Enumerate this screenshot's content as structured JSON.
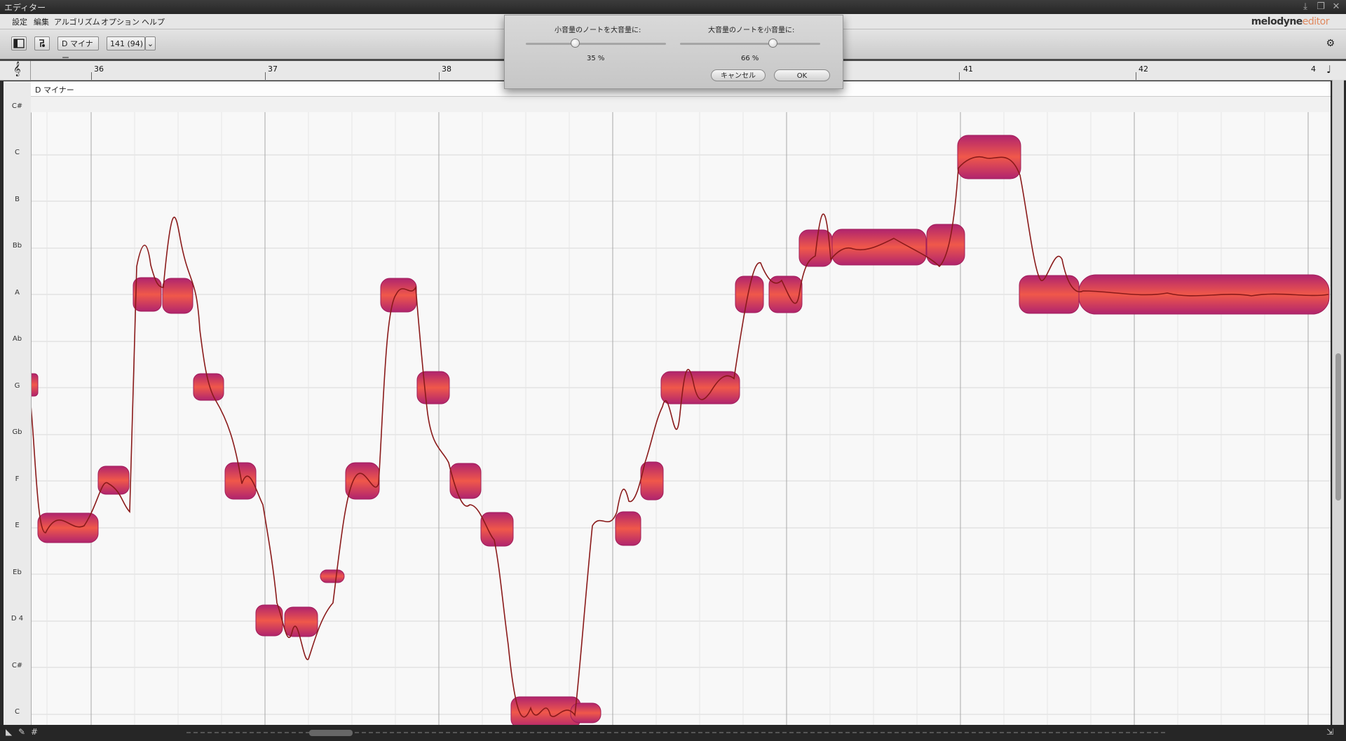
{
  "window": {
    "title": "エディター"
  },
  "menu": [
    "設定",
    "編集",
    "アルゴリズム",
    "オプション",
    "ヘルプ"
  ],
  "brand": {
    "name": "melodyne",
    "suffix": "editor"
  },
  "toolbar": {
    "scale": "D マイナー",
    "tempo": "141 (94)",
    "icons": [
      "sidebar-toggle-icon",
      "pitch-tool-icon",
      "gear-icon"
    ]
  },
  "ruler": {
    "bars": [
      "36",
      "37",
      "38",
      "41",
      "42",
      "4"
    ]
  },
  "scale_band": {
    "label": "D マイナー"
  },
  "pitch_labels": [
    "C#",
    "C",
    "B",
    "Bb",
    "A",
    "Ab",
    "G",
    "Gb",
    "F",
    "E",
    "Eb",
    "D 4",
    "C#",
    "C"
  ],
  "dialog": {
    "left_label": "小音量のノートを大音量に:",
    "left_value": "35 %",
    "left_level": 0.35,
    "right_label": "大音量のノートを小音量に:",
    "right_value": "66 %",
    "right_level": 0.66,
    "cancel": "キャンセル",
    "ok": "OK"
  },
  "colors": {
    "note_fill": "#d03a62",
    "note_edge": "#a01e5a",
    "pitch_curve": "#8a1a1a"
  }
}
